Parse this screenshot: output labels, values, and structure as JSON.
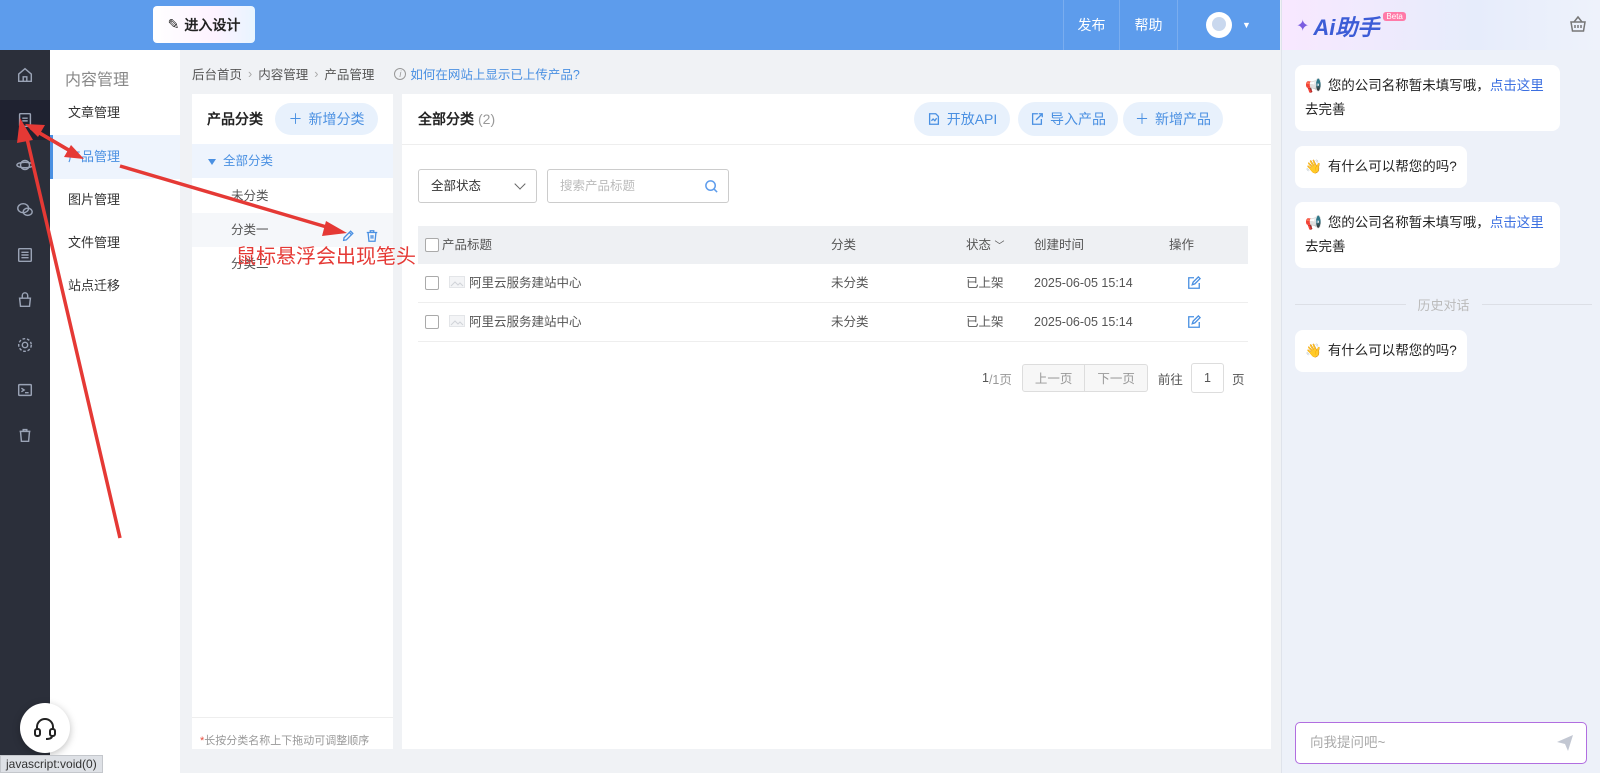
{
  "topbar": {
    "design_label": "进入设计",
    "publish_label": "发布",
    "help_label": "帮助"
  },
  "iconbar": {
    "icons": [
      "home-icon",
      "content-icon",
      "planet-icon",
      "wechat-icon",
      "list-icon",
      "bag-icon",
      "gear-icon",
      "terminal-icon",
      "trash-icon"
    ]
  },
  "submenu": {
    "title": "内容管理",
    "items": [
      {
        "label": "文章管理"
      },
      {
        "label": "产品管理"
      },
      {
        "label": "图片管理"
      },
      {
        "label": "文件管理"
      },
      {
        "label": "站点迁移"
      }
    ]
  },
  "breadcrumb": {
    "items": [
      "后台首页",
      "内容管理",
      "产品管理"
    ],
    "help_link": "如何在网站上显示已上传产品?"
  },
  "categories": {
    "title": "产品分类",
    "add_label": "新增分类",
    "items": [
      "全部分类",
      "未分类",
      "分类一",
      "分类二"
    ],
    "footer_star": "*",
    "footer_text": "长按分类名称上下拖动可调整顺序"
  },
  "main": {
    "title": "全部分类",
    "count": "(2)",
    "buttons": {
      "api": "开放API",
      "import": "导入产品",
      "add": "新增产品"
    },
    "status_filter": "全部状态",
    "search_placeholder": "搜索产品标题",
    "columns": [
      "产品标题",
      "分类",
      "状态",
      "创建时间",
      "操作"
    ],
    "rows": [
      {
        "title": "阿里云服务建站中心",
        "category": "未分类",
        "status": "已上架",
        "created": "2025-06-05 15:14"
      },
      {
        "title": "阿里云服务建站中心",
        "category": "未分类",
        "status": "已上架",
        "created": "2025-06-05 15:14"
      }
    ],
    "pager": {
      "current": "1",
      "total": "/1页",
      "prev": "上一页",
      "next": "下一页",
      "goto": "前往",
      "page_input": "1",
      "page_unit": "页"
    }
  },
  "ai": {
    "title": "Ai助手",
    "badge": "Beta",
    "messages": [
      {
        "emoji": "📢",
        "text": "您的公司名称暂未填写哦，",
        "link": "点击这里",
        "after": "去完善"
      },
      {
        "emoji": "👋",
        "text": "有什么可以帮您的吗?"
      },
      {
        "emoji": "📢",
        "text": "您的公司名称暂未填写哦，",
        "link": "点击这里",
        "after": "去完善"
      },
      {
        "emoji": "👋",
        "text": "有什么可以帮您的吗?"
      }
    ],
    "history_label": "历史对话",
    "input_placeholder": "向我提问吧~"
  },
  "statusbar": {
    "text": "javascript:void(0)"
  },
  "annotation": {
    "text": "鼠标悬浮会出现笔头",
    "color": "#e53935"
  }
}
